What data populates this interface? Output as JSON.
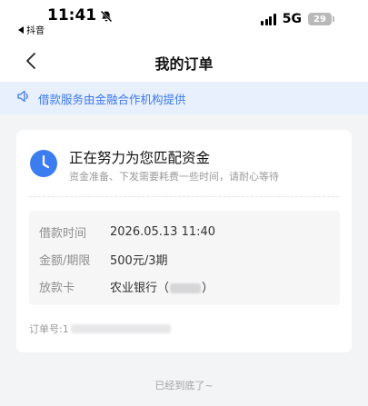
{
  "status_bar": {
    "time": "11:41",
    "back_app": "抖音",
    "network": "5G",
    "battery": "29"
  },
  "nav": {
    "title": "我的订单"
  },
  "notice": {
    "text": "借款服务由金融合作机构提供"
  },
  "order_card": {
    "status_title": "正在努力为您匹配资金",
    "status_subtitle": "资金准备、下发需要耗费一些时间，请耐心等待",
    "details": [
      {
        "label": "借款时间",
        "value": "2026.05.13 11:40"
      },
      {
        "label": "金额/期限",
        "value": "500元/3期"
      },
      {
        "label": "放款卡",
        "value_prefix": "农业银行（",
        "value_suffix": "）"
      }
    ],
    "order_label": "订单号:1"
  },
  "footer": {
    "end_text": "已经到底了~"
  },
  "colors": {
    "accent": "#3b7cf0",
    "notice_bg": "#e8f0fd",
    "page_bg": "#f3f4f6"
  }
}
